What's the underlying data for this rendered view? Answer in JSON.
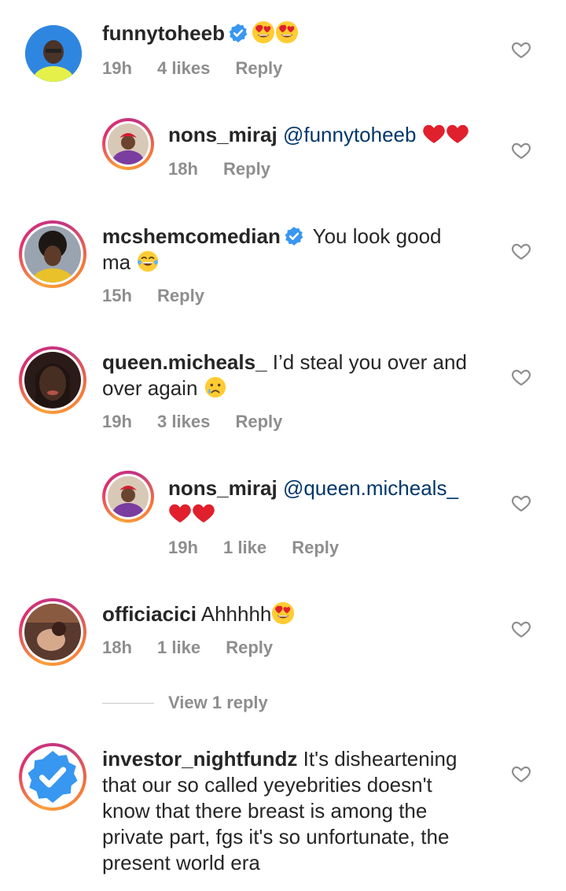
{
  "comments": [
    {
      "username": "funnytoheeb",
      "text": "",
      "time": "19h",
      "likes": "4 likes",
      "reply": "Reply"
    },
    {
      "username": "nons_miraj",
      "mention": "@funnytoheeb",
      "time": "18h",
      "reply": "Reply"
    },
    {
      "username": "mcshemcomedian",
      "text_line1": "You look good",
      "text_line2": "ma",
      "time": "15h",
      "reply": "Reply"
    },
    {
      "username": "queen.micheals_",
      "text_line1": "I’d steal you over and",
      "text_line2": "over again",
      "time": "19h",
      "likes": "3 likes",
      "reply": "Reply"
    },
    {
      "username": "nons_miraj",
      "mention": "@queen.micheals_",
      "time": "19h",
      "likes": "1 like",
      "reply": "Reply"
    },
    {
      "username": "officiacici",
      "text": "Ahhhhh",
      "time": "18h",
      "likes": "1 like",
      "reply": "Reply"
    },
    {
      "username": "investor_nightfundz",
      "text_line1": "It's disheartening",
      "text_line2": "that our so called yeyebrities doesn't",
      "text_line3": "know that there breast is among the",
      "text_line4": "private part, fgs it's so unfortunate, the",
      "text_line5": "present world era"
    }
  ],
  "view_replies": "View 1 reply",
  "colors": {
    "text": "#262626",
    "meta": "#8e8e8e",
    "mention": "#00376b",
    "verified": "#3897f0",
    "heart_red": "#ed4956"
  }
}
